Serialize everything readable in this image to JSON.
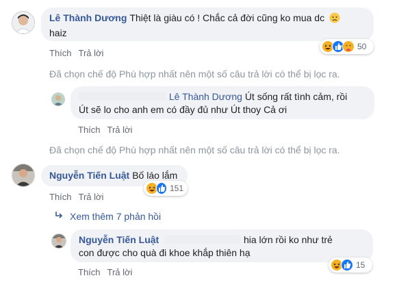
{
  "comments": [
    {
      "author": "Lê Thành Dương",
      "text_line1": "Thiệt là giàu có ! Chắc cả đời cũng ko mua dc",
      "text_line2": "haiz",
      "reaction_count": "50",
      "like_label": "Thích",
      "reply_label": "Trả lời"
    },
    {
      "tagged_name": "Lê Thành Dương",
      "text_line1": "Út sống rất tình cảm, rồi",
      "text_line2": "Út sẽ lo cho anh em có đầy đủ như Út thoy Cả ơi",
      "like_label": "Thích",
      "reply_label": "Trả lời"
    },
    {
      "author": "Nguyễn Tiến Luật",
      "text": "Bố láo lắm",
      "reaction_count": "151",
      "like_label": "Thích",
      "reply_label": "Trả lời"
    },
    {
      "author": "Nguyễn Tiến Luật",
      "text_line1": "hia lớn rồi ko như trẻ",
      "text_line2": "con được cho quà đi khoe khắp thiên hạ",
      "reaction_count": "15",
      "like_label": "Thích",
      "reply_label": "Trả lời"
    }
  ],
  "filter_notice": "Đã chọn chế độ Phù hợp nhất nên một số câu trả lời có thể bị lọc ra.",
  "view_more": "Xem thêm 7 phản hồi",
  "colors": {
    "name": "#365899",
    "bubble": "#f0f2f5",
    "meta": "#606770",
    "notice": "#8d949e"
  }
}
